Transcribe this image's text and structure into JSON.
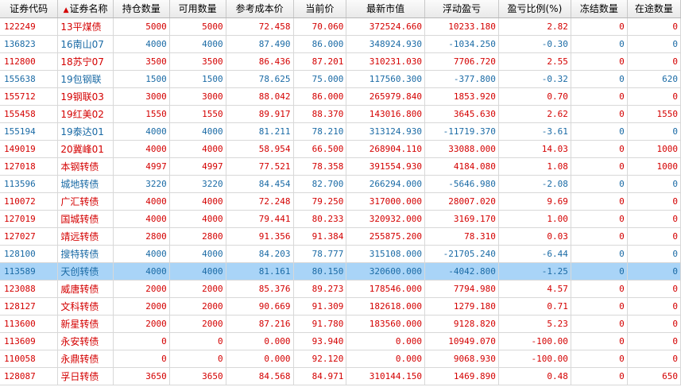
{
  "colors": {
    "up": "#d40000",
    "down": "#1a6aa5",
    "selected_row": "#a9d4f7"
  },
  "headers": {
    "code": "证券代码",
    "name": "证券名称",
    "holding": "持仓数量",
    "available": "可用数量",
    "cost": "参考成本价",
    "price": "当前价",
    "market_value": "最新市值",
    "float_pnl": "浮动盈亏",
    "pnl_ratio": "盈亏比例(%)",
    "frozen": "冻结数量",
    "in_transit": "在途数量"
  },
  "sort_icon": "sort-up-triangle-icon",
  "rows": [
    {
      "code": "122249",
      "name": "13平煤债",
      "holding": "5000",
      "available": "5000",
      "cost": "72.458",
      "price": "70.060",
      "market_value": "372524.660",
      "float_pnl": "10233.180",
      "pnl_ratio": "2.82",
      "frozen": "0",
      "in_transit": "0",
      "trend": "up"
    },
    {
      "code": "136823",
      "name": "16南山07",
      "holding": "4000",
      "available": "4000",
      "cost": "87.490",
      "price": "86.000",
      "market_value": "348924.930",
      "float_pnl": "-1034.250",
      "pnl_ratio": "-0.30",
      "frozen": "0",
      "in_transit": "0",
      "trend": "down"
    },
    {
      "code": "112800",
      "name": "18苏宁07",
      "holding": "3500",
      "available": "3500",
      "cost": "86.436",
      "price": "87.201",
      "market_value": "310231.030",
      "float_pnl": "7706.720",
      "pnl_ratio": "2.55",
      "frozen": "0",
      "in_transit": "0",
      "trend": "up"
    },
    {
      "code": "155638",
      "name": "19包钢联",
      "holding": "1500",
      "available": "1500",
      "cost": "78.625",
      "price": "75.000",
      "market_value": "117560.300",
      "float_pnl": "-377.800",
      "pnl_ratio": "-0.32",
      "frozen": "0",
      "in_transit": "620",
      "trend": "down"
    },
    {
      "code": "155712",
      "name": "19钢联03",
      "holding": "3000",
      "available": "3000",
      "cost": "88.042",
      "price": "86.000",
      "market_value": "265979.840",
      "float_pnl": "1853.920",
      "pnl_ratio": "0.70",
      "frozen": "0",
      "in_transit": "0",
      "trend": "up"
    },
    {
      "code": "155458",
      "name": "19红美02",
      "holding": "1550",
      "available": "1550",
      "cost": "89.917",
      "price": "88.370",
      "market_value": "143016.800",
      "float_pnl": "3645.630",
      "pnl_ratio": "2.62",
      "frozen": "0",
      "in_transit": "1550",
      "trend": "up"
    },
    {
      "code": "155194",
      "name": "19泰达01",
      "holding": "4000",
      "available": "4000",
      "cost": "81.211",
      "price": "78.210",
      "market_value": "313124.930",
      "float_pnl": "-11719.370",
      "pnl_ratio": "-3.61",
      "frozen": "0",
      "in_transit": "0",
      "trend": "down"
    },
    {
      "code": "149019",
      "name": "20冀峰01",
      "holding": "4000",
      "available": "4000",
      "cost": "58.954",
      "price": "66.500",
      "market_value": "268904.110",
      "float_pnl": "33088.000",
      "pnl_ratio": "14.03",
      "frozen": "0",
      "in_transit": "1000",
      "trend": "up"
    },
    {
      "code": "127018",
      "name": "本钢转债",
      "holding": "4997",
      "available": "4997",
      "cost": "77.521",
      "price": "78.358",
      "market_value": "391554.930",
      "float_pnl": "4184.080",
      "pnl_ratio": "1.08",
      "frozen": "0",
      "in_transit": "1000",
      "trend": "up"
    },
    {
      "code": "113596",
      "name": "城地转债",
      "holding": "3220",
      "available": "3220",
      "cost": "84.454",
      "price": "82.700",
      "market_value": "266294.000",
      "float_pnl": "-5646.980",
      "pnl_ratio": "-2.08",
      "frozen": "0",
      "in_transit": "0",
      "trend": "down"
    },
    {
      "code": "110072",
      "name": "广汇转债",
      "holding": "4000",
      "available": "4000",
      "cost": "72.248",
      "price": "79.250",
      "market_value": "317000.000",
      "float_pnl": "28007.020",
      "pnl_ratio": "9.69",
      "frozen": "0",
      "in_transit": "0",
      "trend": "up"
    },
    {
      "code": "127019",
      "name": "国城转债",
      "holding": "4000",
      "available": "4000",
      "cost": "79.441",
      "price": "80.233",
      "market_value": "320932.000",
      "float_pnl": "3169.170",
      "pnl_ratio": "1.00",
      "frozen": "0",
      "in_transit": "0",
      "trend": "up"
    },
    {
      "code": "127027",
      "name": "靖远转债",
      "holding": "2800",
      "available": "2800",
      "cost": "91.356",
      "price": "91.384",
      "market_value": "255875.200",
      "float_pnl": "78.310",
      "pnl_ratio": "0.03",
      "frozen": "0",
      "in_transit": "0",
      "trend": "up"
    },
    {
      "code": "128100",
      "name": "搜特转债",
      "holding": "4000",
      "available": "4000",
      "cost": "84.203",
      "price": "78.777",
      "market_value": "315108.000",
      "float_pnl": "-21705.240",
      "pnl_ratio": "-6.44",
      "frozen": "0",
      "in_transit": "0",
      "trend": "down"
    },
    {
      "code": "113589",
      "name": "天创转债",
      "holding": "4000",
      "available": "4000",
      "cost": "81.161",
      "price": "80.150",
      "market_value": "320600.000",
      "float_pnl": "-4042.800",
      "pnl_ratio": "-1.25",
      "frozen": "0",
      "in_transit": "0",
      "trend": "down",
      "selected": true
    },
    {
      "code": "123088",
      "name": "威唐转债",
      "holding": "2000",
      "available": "2000",
      "cost": "85.376",
      "price": "89.273",
      "market_value": "178546.000",
      "float_pnl": "7794.980",
      "pnl_ratio": "4.57",
      "frozen": "0",
      "in_transit": "0",
      "trend": "up"
    },
    {
      "code": "128127",
      "name": "文科转债",
      "holding": "2000",
      "available": "2000",
      "cost": "90.669",
      "price": "91.309",
      "market_value": "182618.000",
      "float_pnl": "1279.180",
      "pnl_ratio": "0.71",
      "frozen": "0",
      "in_transit": "0",
      "trend": "up"
    },
    {
      "code": "113600",
      "name": "新星转债",
      "holding": "2000",
      "available": "2000",
      "cost": "87.216",
      "price": "91.780",
      "market_value": "183560.000",
      "float_pnl": "9128.820",
      "pnl_ratio": "5.23",
      "frozen": "0",
      "in_transit": "0",
      "trend": "up"
    },
    {
      "code": "113609",
      "name": "永安转债",
      "holding": "0",
      "available": "0",
      "cost": "0.000",
      "price": "93.940",
      "market_value": "0.000",
      "float_pnl": "10949.070",
      "pnl_ratio": "-100.00",
      "frozen": "0",
      "in_transit": "0",
      "trend": "up"
    },
    {
      "code": "110058",
      "name": "永鼎转债",
      "holding": "0",
      "available": "0",
      "cost": "0.000",
      "price": "92.120",
      "market_value": "0.000",
      "float_pnl": "9068.930",
      "pnl_ratio": "-100.00",
      "frozen": "0",
      "in_transit": "0",
      "trend": "up"
    },
    {
      "code": "128087",
      "name": "孚日转债",
      "holding": "3650",
      "available": "3650",
      "cost": "84.568",
      "price": "84.971",
      "market_value": "310144.150",
      "float_pnl": "1469.890",
      "pnl_ratio": "0.48",
      "frozen": "0",
      "in_transit": "650",
      "trend": "up"
    }
  ]
}
